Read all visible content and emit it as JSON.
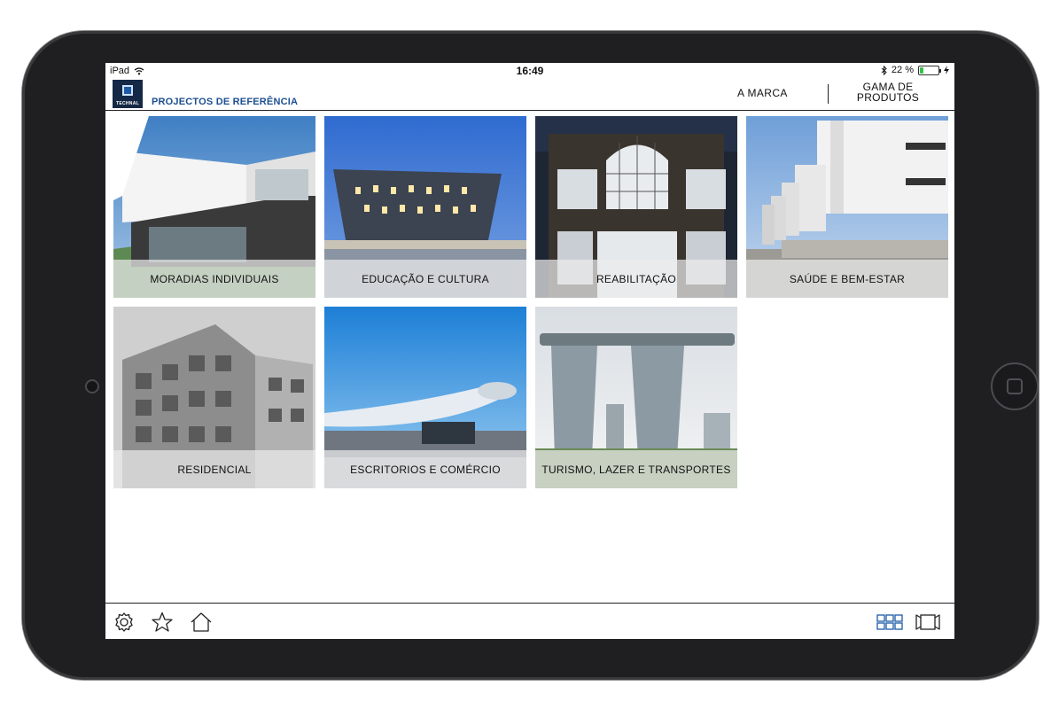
{
  "status_bar": {
    "device": "iPad",
    "time": "16:49",
    "battery": "22 %",
    "battery_level": 0.22
  },
  "header": {
    "logo_text": "TECHNAL",
    "page_title": "PROJECTOS DE REFERÊNCIA",
    "nav_marca": "A MARCA",
    "nav_gama_line1": "GAMA DE",
    "nav_gama_line2": "PRODUTOS"
  },
  "categories": [
    {
      "label": "MORADIAS INDIVIDUAIS"
    },
    {
      "label": "EDUCAÇÃO E CULTURA"
    },
    {
      "label": "REABILITAÇÃO"
    },
    {
      "label": "SAÚDE E BEM-ESTAR"
    },
    {
      "label": "RESIDENCIAL"
    },
    {
      "label": "ESCRITORIOS E COMÉRCIO"
    },
    {
      "label": "TURISMO, LAZER E TRANSPORTES"
    }
  ],
  "toolbar": {
    "left_icons": [
      "gear-icon",
      "star-icon",
      "home-icon"
    ],
    "right_icons": [
      "grid-view-icon",
      "video-icon"
    ],
    "accent": "#1d5aa6"
  }
}
